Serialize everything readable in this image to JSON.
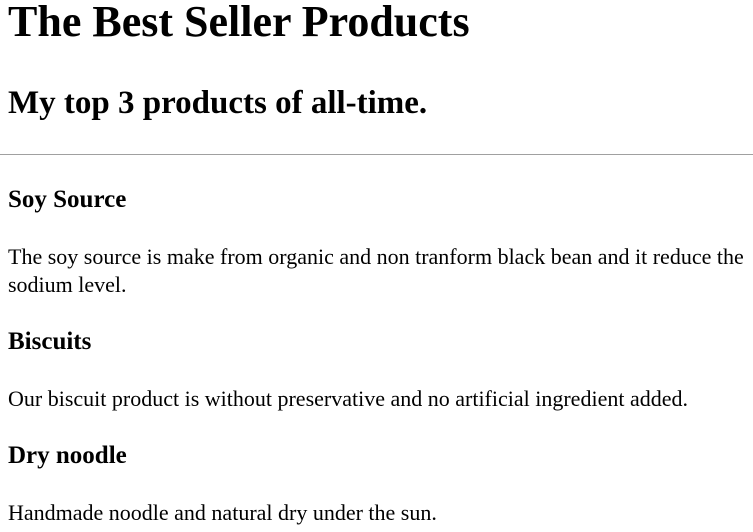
{
  "header": {
    "title": "The Best Seller Products",
    "subtitle": "My top 3 products of all-time."
  },
  "products": [
    {
      "name": "Soy Source",
      "description": "The soy source is make from organic and non tranform black bean and it reduce the sodium level."
    },
    {
      "name": "Biscuits",
      "description": "Our biscuit product is without preservative and no artificial ingredient added."
    },
    {
      "name": "Dry noodle",
      "description": "Handmade noodle and natural dry under the sun."
    }
  ]
}
